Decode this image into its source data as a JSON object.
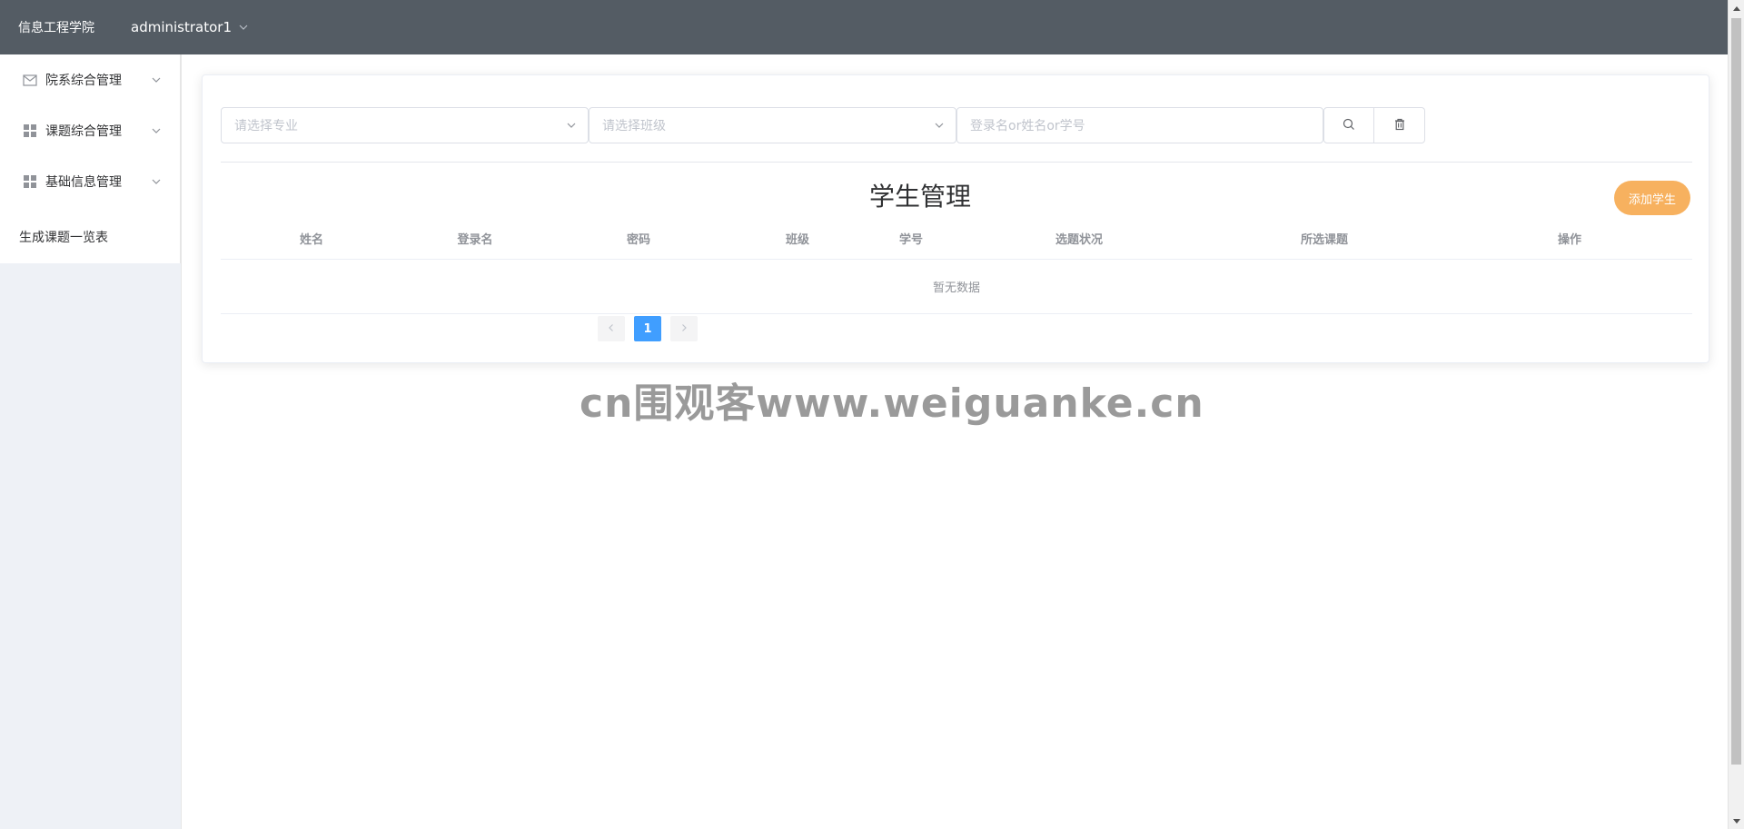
{
  "header": {
    "brand": "信息工程学院",
    "user": "administrator1"
  },
  "sidebar": {
    "items": [
      {
        "label": "院系综合管理",
        "icon": "mail-icon"
      },
      {
        "label": "课题综合管理",
        "icon": "grid-icon"
      },
      {
        "label": "基础信息管理",
        "icon": "grid-icon"
      }
    ],
    "leaf": "生成课题一览表"
  },
  "filters": {
    "major_placeholder": "请选择专业",
    "class_placeholder": "请选择班级",
    "search_placeholder": "登录名or姓名or学号"
  },
  "main": {
    "title": "学生管理",
    "add_button": "添加学生"
  },
  "table": {
    "columns": [
      "姓名",
      "登录名",
      "密码",
      "班级",
      "学号",
      "选题状况",
      "所选课题",
      "操作"
    ],
    "empty_text": "暂无数据"
  },
  "pagination": {
    "current": "1",
    "prev_icon": "chevron-left-icon",
    "next_icon": "chevron-right-icon"
  },
  "watermark": "cn围观客www.weiguanke.cn",
  "colors": {
    "header_bg": "#545c64",
    "accent": "#409eff",
    "add_button_bg": "#f7b15f"
  }
}
